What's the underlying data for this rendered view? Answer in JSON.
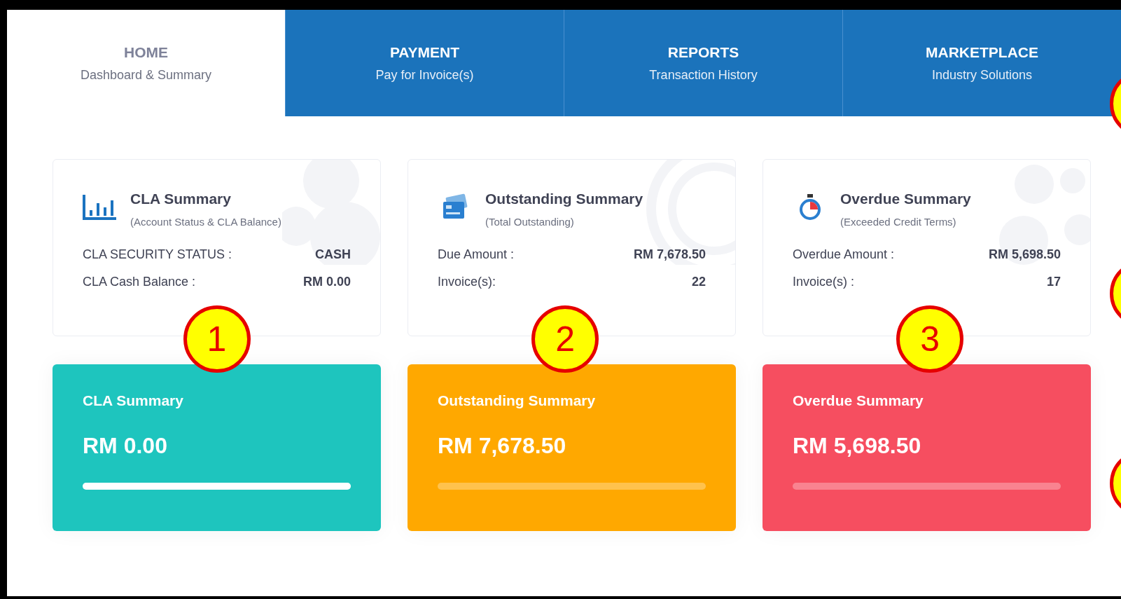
{
  "tabs": [
    {
      "title": "HOME",
      "subtitle": "Dashboard & Summary",
      "selected": true
    },
    {
      "title": "PAYMENT",
      "subtitle": "Pay for Invoice(s)",
      "selected": false
    },
    {
      "title": "REPORTS",
      "subtitle": "Transaction History",
      "selected": false
    },
    {
      "title": "MARKETPLACE",
      "subtitle": "Industry Solutions",
      "selected": false
    }
  ],
  "summary_cards": [
    {
      "kind": "chart",
      "title": "CLA Summary",
      "subtitle": "(Account Status & CLA Balance)",
      "rows": [
        {
          "label": "CLA SECURITY STATUS :",
          "value": "CASH"
        },
        {
          "label": "CLA Cash Balance :",
          "value": "RM 0.00"
        }
      ],
      "callout": "1"
    },
    {
      "kind": "card",
      "title": "Outstanding Summary",
      "subtitle": "(Total Outstanding)",
      "rows": [
        {
          "label": "Due Amount :",
          "value": "RM 7,678.50"
        },
        {
          "label": "Invoice(s):",
          "value": "22"
        }
      ],
      "callout": "2"
    },
    {
      "kind": "timer",
      "title": "Overdue Summary",
      "subtitle": "(Exceeded Credit Terms)",
      "rows": [
        {
          "label": "Overdue Amount :",
          "value": "RM 5,698.50"
        },
        {
          "label": "Invoice(s) :",
          "value": "17"
        }
      ],
      "callout": "3"
    }
  ],
  "stat_cards": [
    {
      "title": "CLA Summary",
      "amount": "RM 0.00",
      "level": 1,
      "color": "#1ec5be"
    },
    {
      "title": "Outstanding Summary",
      "amount": "RM 7,678.50",
      "level": 0,
      "color": "#ffa800"
    },
    {
      "title": "Overdue Summary",
      "amount": "RM 5,698.50",
      "level": 0,
      "color": "#f64e60"
    }
  ]
}
